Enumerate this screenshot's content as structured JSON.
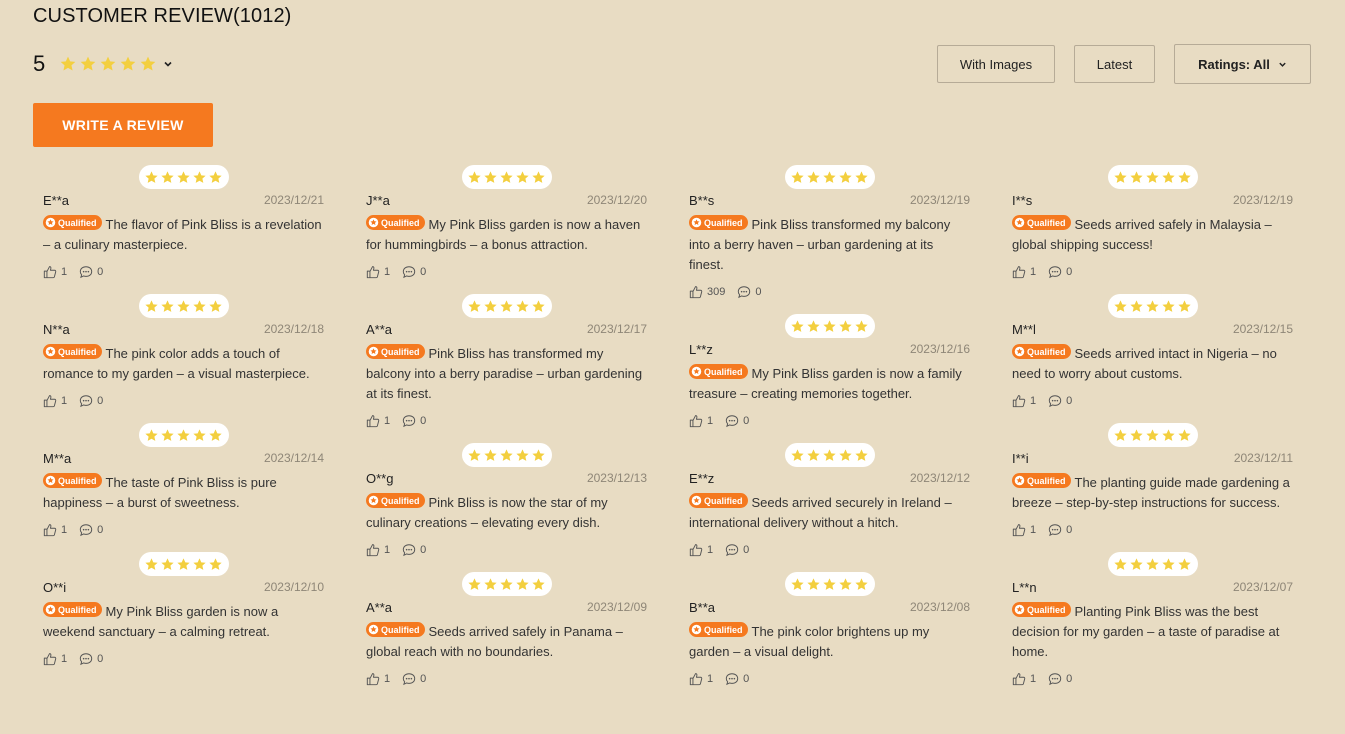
{
  "header": {
    "title": "CUSTOMER REVIEW(1012)",
    "average": "5",
    "average_stars": 5
  },
  "filters": {
    "with_images": "With Images",
    "latest": "Latest",
    "ratings": "Ratings: All"
  },
  "write_review": "WRITE A REVIEW",
  "badge_label": "Qualified",
  "colors": {
    "accent": "#f5791f",
    "star": "#f3cf3f",
    "background": "#e8dcc3"
  },
  "columns": [
    [
      {
        "name": "E**a",
        "date": "2023/12/21",
        "stars": 5,
        "text": "The flavor of Pink Bliss is a revelation – a culinary masterpiece.",
        "likes": "1",
        "comments": "0"
      },
      {
        "name": "N**a",
        "date": "2023/12/18",
        "stars": 5,
        "text": "The pink color adds a touch of romance to my garden – a visual masterpiece.",
        "likes": "1",
        "comments": "0"
      },
      {
        "name": "M**a",
        "date": "2023/12/14",
        "stars": 5,
        "text": "The taste of Pink Bliss is pure happiness – a burst of sweetness.",
        "likes": "1",
        "comments": "0"
      },
      {
        "name": "O**i",
        "date": "2023/12/10",
        "stars": 5,
        "text": "My Pink Bliss garden is now a weekend sanctuary – a calming retreat.",
        "likes": "1",
        "comments": "0"
      }
    ],
    [
      {
        "name": "J**a",
        "date": "2023/12/20",
        "stars": 5,
        "text": "My Pink Bliss garden is now a haven for hummingbirds – a bonus attraction.",
        "likes": "1",
        "comments": "0"
      },
      {
        "name": "A**a",
        "date": "2023/12/17",
        "stars": 5,
        "text": "Pink Bliss has transformed my balcony into a berry paradise – urban gardening at its finest.",
        "likes": "1",
        "comments": "0"
      },
      {
        "name": "O**g",
        "date": "2023/12/13",
        "stars": 5,
        "text": "Pink Bliss is now the star of my culinary creations – elevating every dish.",
        "likes": "1",
        "comments": "0"
      },
      {
        "name": "A**a",
        "date": "2023/12/09",
        "stars": 5,
        "text": "Seeds arrived safely in Panama – global reach with no boundaries.",
        "likes": "1",
        "comments": "0"
      }
    ],
    [
      {
        "name": "B**s",
        "date": "2023/12/19",
        "stars": 5,
        "text": "Pink Bliss transformed my balcony into a berry haven – urban gardening at its finest.",
        "likes": "309",
        "comments": "0"
      },
      {
        "name": "L**z",
        "date": "2023/12/16",
        "stars": 5,
        "text": "My Pink Bliss garden is now a family treasure – creating memories together.",
        "likes": "1",
        "comments": "0"
      },
      {
        "name": "E**z",
        "date": "2023/12/12",
        "stars": 5,
        "text": "Seeds arrived securely in Ireland – international delivery without a hitch.",
        "likes": "1",
        "comments": "0"
      },
      {
        "name": "B**a",
        "date": "2023/12/08",
        "stars": 5,
        "text": "The pink color brightens up my garden – a visual delight.",
        "likes": "1",
        "comments": "0"
      }
    ],
    [
      {
        "name": "I**s",
        "date": "2023/12/19",
        "stars": 5,
        "text": "Seeds arrived safely in Malaysia – global shipping success!",
        "likes": "1",
        "comments": "0"
      },
      {
        "name": "M**l",
        "date": "2023/12/15",
        "stars": 5,
        "text": "Seeds arrived intact in Nigeria – no need to worry about customs.",
        "likes": "1",
        "comments": "0"
      },
      {
        "name": "I**i",
        "date": "2023/12/11",
        "stars": 5,
        "text": "The planting guide made gardening a breeze – step-by-step instructions for success.",
        "likes": "1",
        "comments": "0"
      },
      {
        "name": "L**n",
        "date": "2023/12/07",
        "stars": 5,
        "text": "Planting Pink Bliss was the best decision for my garden – a taste of paradise at home.",
        "likes": "1",
        "comments": "0"
      }
    ]
  ]
}
